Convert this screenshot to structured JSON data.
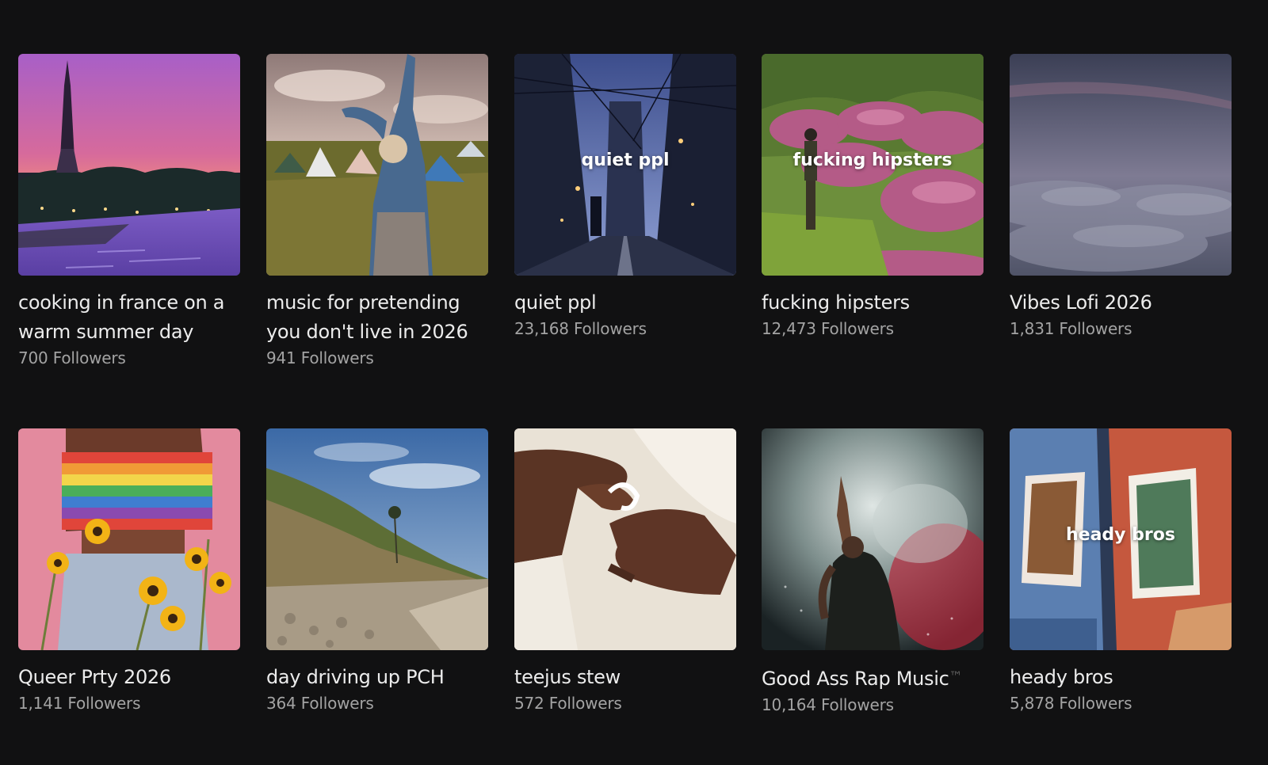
{
  "playlists": [
    {
      "title": "cooking in france on a warm summer day",
      "followers": "700 Followers",
      "overlay": "",
      "image": "eiffel-tower-sunset"
    },
    {
      "title": "music for pretending you don't live in 2026",
      "followers": "941 Followers",
      "overlay": "",
      "image": "festival-dancer"
    },
    {
      "title": "quiet ppl",
      "followers": "23,168 Followers",
      "overlay": "quiet ppl",
      "image": "evening-street"
    },
    {
      "title": "fucking hipsters",
      "followers": "12,473 Followers",
      "overlay": "fucking hipsters",
      "image": "flower-hillside"
    },
    {
      "title": "Vibes Lofi 2026",
      "followers": "1,831 Followers",
      "overlay": "",
      "image": "clouds"
    },
    {
      "title": "Queer Prty 2026",
      "followers": "1,141 Followers",
      "overlay": "",
      "image": "rainbow-top-sunflowers"
    },
    {
      "title": "day driving up PCH",
      "followers": "364 Followers",
      "overlay": "",
      "image": "coastal-cliff"
    },
    {
      "title": "teejus stew",
      "followers": "572 Followers",
      "overlay": "",
      "image": "hands-closeup"
    },
    {
      "title": "Good Ass Rap Music",
      "title_suffix": "™",
      "followers": "10,164 Followers",
      "overlay": "",
      "image": "performer-smoke"
    },
    {
      "title": "heady bros",
      "followers": "5,878 Followers",
      "overlay": "heady bros",
      "image": "painted-windows"
    }
  ]
}
